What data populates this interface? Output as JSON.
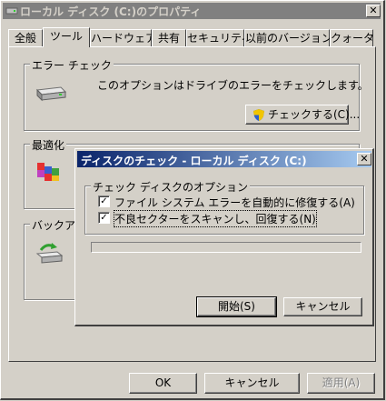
{
  "window": {
    "title": "ローカル ディスク (C:)のプロパティ",
    "close_glyph": "✕"
  },
  "tabs": [
    {
      "label": "全般",
      "active": false
    },
    {
      "label": "ツール",
      "active": true
    },
    {
      "label": "ハードウェア",
      "active": false
    },
    {
      "label": "共有",
      "active": false
    },
    {
      "label": "セキュリティ",
      "active": false
    },
    {
      "label": "以前のバージョン",
      "active": false
    },
    {
      "label": "クォータ",
      "active": false
    }
  ],
  "error_check": {
    "legend": "エラー チェック",
    "description": "このオプションはドライブのエラーをチェックします。",
    "button_label": "チェックする(C)..."
  },
  "defrag": {
    "legend": "最適化"
  },
  "backup": {
    "legend": "バックアップ"
  },
  "footer": {
    "ok_label": "OK",
    "cancel_label": "キャンセル",
    "apply_label": "適用(A)"
  },
  "disk_check_dialog": {
    "title": "ディスクのチェック - ローカル ディスク (C:)",
    "close_glyph": "✕",
    "options_legend": "チェック ディスクのオプション",
    "option1": {
      "label": "ファイル システム エラーを自動的に修復する(A)",
      "checked": true
    },
    "option2": {
      "label": "不良セクターをスキャンし、回復する(N)",
      "checked": true
    },
    "check_glyph": "✓",
    "progress_value": 0,
    "start_label": "開始(S)",
    "cancel_label": "キャンセル"
  },
  "colors": {
    "face": "#d4d0c8",
    "active_title_start": "#0a246a",
    "active_title_end": "#a6caf0",
    "inactive_title": "#808080"
  },
  "icons": {
    "title_icon": "drive-icon",
    "error_check_icon": "hard-drive-icon",
    "check_button_icon": "uac-shield-icon",
    "defrag_icon": "defragment-icon",
    "backup_icon": "backup-icon"
  }
}
